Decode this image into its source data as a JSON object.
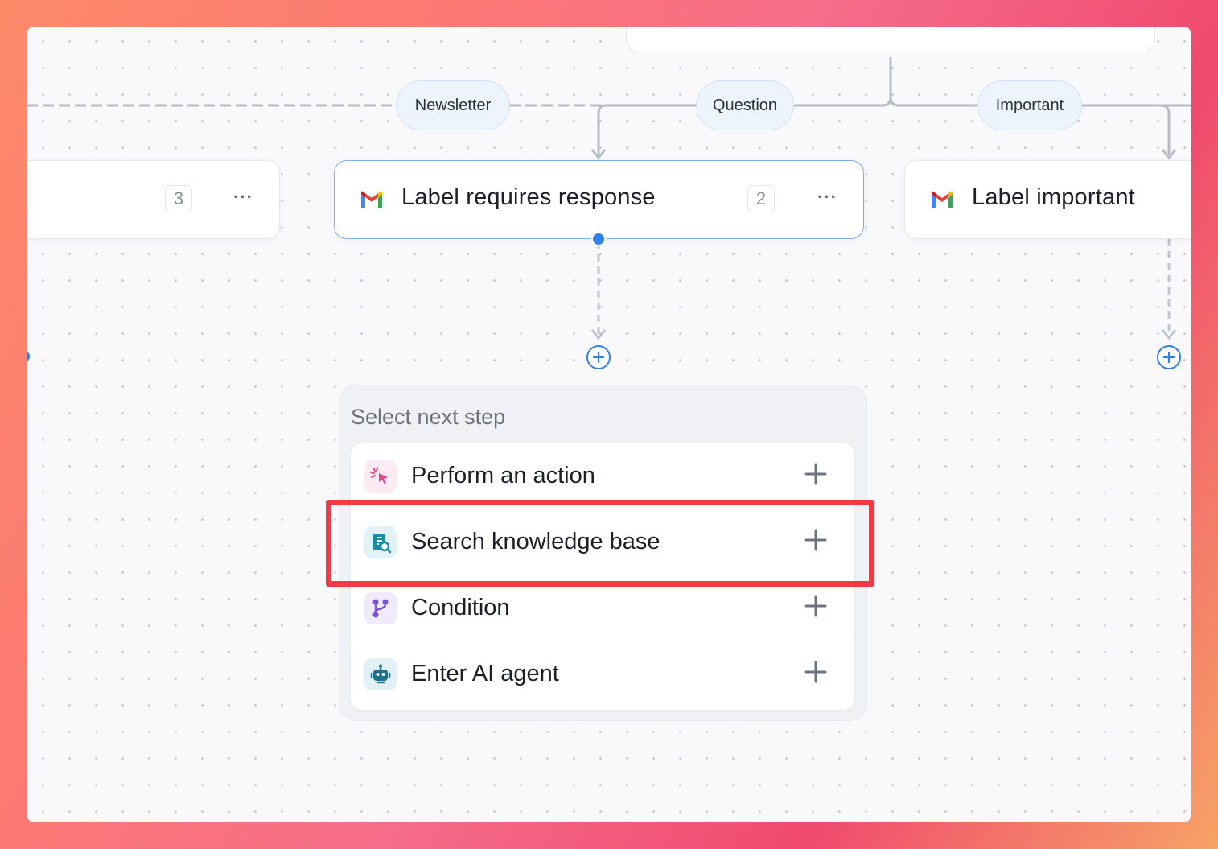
{
  "canvas": {
    "route_labels": [
      "Newsletter",
      "Question",
      "Important"
    ]
  },
  "nodes": {
    "left": {
      "count": "3",
      "more": "···"
    },
    "center": {
      "title": "Label requires response",
      "count": "2",
      "more": "···",
      "icon": "gmail-icon"
    },
    "right": {
      "title": "Label important",
      "icon": "gmail-icon"
    }
  },
  "next_step_menu": {
    "title": "Select next step",
    "items": [
      {
        "label": "Perform an action",
        "icon": "sparkle-cursor-icon"
      },
      {
        "label": "Search knowledge base",
        "icon": "knowledge-base-icon"
      },
      {
        "label": "Condition",
        "icon": "branch-icon"
      },
      {
        "label": "Enter AI agent",
        "icon": "robot-icon"
      }
    ],
    "highlighted_item": "Search knowledge base"
  },
  "colors": {
    "accent": "#2f80ed",
    "highlight": "#f03a45",
    "action_icon": "#e0458f",
    "knowledge_icon": "#1e88a8",
    "condition_icon": "#7b4fd6",
    "agent_icon": "#1f6f8b"
  }
}
